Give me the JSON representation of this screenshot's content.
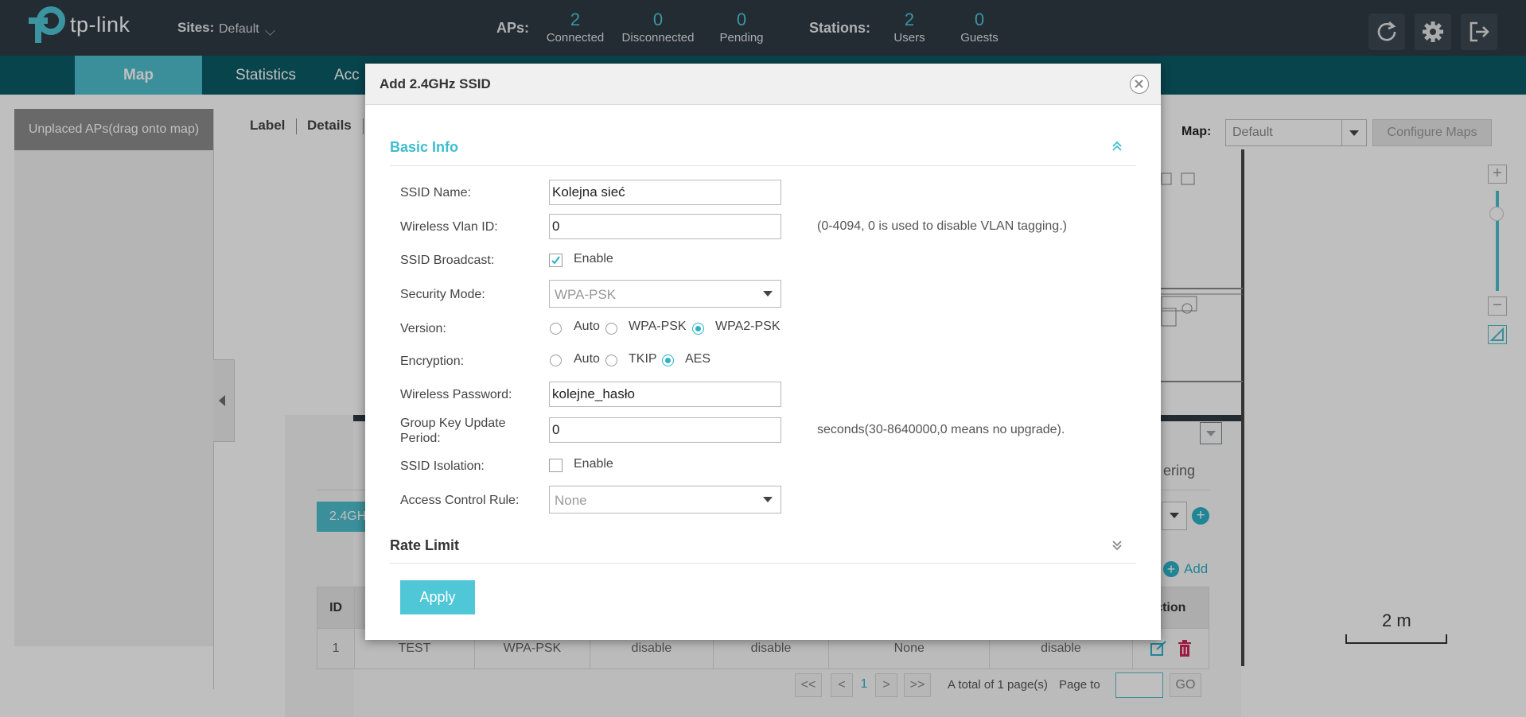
{
  "header": {
    "logo_text": "tp-link",
    "sites_label": "Sites:",
    "sites_value": "Default",
    "aps_label": "APs:",
    "stations_label": "Stations:",
    "stats": [
      {
        "value": "2",
        "label": "Connected"
      },
      {
        "value": "0",
        "label": "Disconnected"
      },
      {
        "value": "0",
        "label": "Pending"
      },
      {
        "value": "2",
        "label": "Users"
      },
      {
        "value": "0",
        "label": "Guests"
      }
    ],
    "icons": [
      "refresh-icon",
      "gear-icon",
      "logout-icon"
    ]
  },
  "nav": {
    "items": [
      "Map",
      "Statistics",
      "Acc"
    ],
    "active": "Map"
  },
  "left_panel": {
    "title": "Unplaced APs(drag onto map)"
  },
  "subnav": {
    "items": [
      "Label",
      "Details"
    ]
  },
  "map_controls": {
    "map_label": "Map:",
    "map_value": "Default",
    "configure_label": "Configure Maps",
    "scale_label": "2 m"
  },
  "ssid_panel": {
    "band_tab": "2.4GH",
    "right_tab": "ering",
    "add_label": "Add",
    "table": {
      "headers": [
        "ID",
        "",
        "",
        "",
        "",
        "",
        "",
        "ction"
      ],
      "rows": [
        [
          "1",
          "TEST",
          "WPA-PSK",
          "disable",
          "disable",
          "None",
          "disable"
        ]
      ]
    },
    "pager": {
      "first": "<<",
      "prev": "<",
      "current": "1",
      "next": ">",
      "last": ">>",
      "total": "A total of 1 page(s)",
      "page_to": "Page to",
      "go": "GO"
    }
  },
  "modal": {
    "title": "Add 2.4GHz SSID",
    "basic_info": "Basic Info",
    "rate_limit": "Rate Limit",
    "fields": {
      "ssid_name_label": "SSID Name:",
      "ssid_name_value": "Kolejna sieć",
      "vlan_label": "Wireless Vlan ID:",
      "vlan_value": "0",
      "vlan_hint": "(0-4094, 0 is used to disable VLAN tagging.)",
      "broadcast_label": "SSID Broadcast:",
      "broadcast_option": "Enable",
      "security_label": "Security Mode:",
      "security_value": "WPA-PSK",
      "version_label": "Version:",
      "version_options": [
        "Auto",
        "WPA-PSK",
        "WPA2-PSK"
      ],
      "version_selected": "WPA2-PSK",
      "encryption_label": "Encryption:",
      "encryption_options": [
        "Auto",
        "TKIP",
        "AES"
      ],
      "encryption_selected": "AES",
      "password_label": "Wireless Password:",
      "password_value": "kolejne_hasło",
      "group_key_label_1": "Group Key Update",
      "group_key_label_2": "Period:",
      "group_key_value": "0",
      "group_key_hint": "seconds(30-8640000,0 means no upgrade).",
      "isolation_label": "SSID Isolation:",
      "isolation_option": "Enable",
      "acl_label": "Access Control Rule:",
      "acl_value": "None"
    },
    "apply_label": "Apply"
  },
  "colors": {
    "accent": "#4fbfce",
    "header_bg": "#2f3a44",
    "nav_bg": "#0b5b66",
    "delete": "#d0245b"
  }
}
